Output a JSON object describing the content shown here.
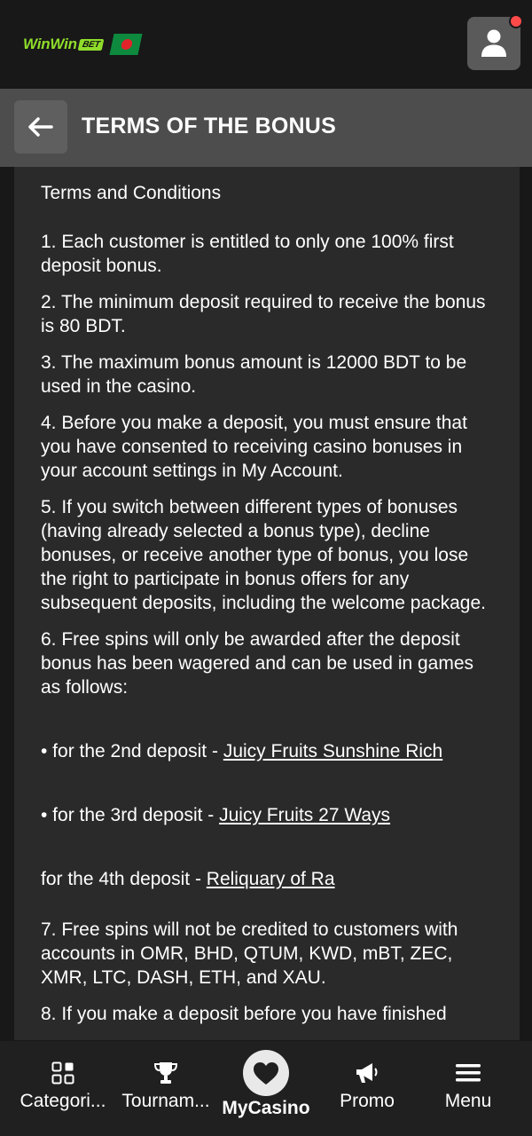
{
  "brand": {
    "logo_text": "WinWin",
    "logo_badge": "BET"
  },
  "header": {
    "title": "TERMS OF THE BONUS"
  },
  "terms": {
    "heading": "Terms and Conditions",
    "items": [
      "1. Each customer is entitled to only one 100% first deposit bonus.",
      "2. The minimum deposit required to receive the bonus is 80 BDT.",
      "3. The maximum bonus amount is 12000 BDT to be used in the casino.",
      "4. Before you make a deposit, you must ensure that you have consented to receiving casino bonuses in your account settings in My Account.",
      "5. If you switch between different types of bonuses (having already selected a bonus type), decline bonuses, or receive another type of bonus, you lose the right to participate in bonus offers for any subsequent deposits, including the welcome package.",
      "6. Free spins will only be awarded after the deposit bonus has been wagered and can be used in games as follows:"
    ],
    "games": [
      {
        "prefix": "• for the 2nd deposit - ",
        "link": "Juicy Fruits Sunshine Rich"
      },
      {
        "prefix": "• for the 3rd deposit - ",
        "link": "Juicy Fruits 27 Ways"
      },
      {
        "prefix": "for the 4th deposit - ",
        "link": "Reliquary of Ra"
      }
    ],
    "item7": "7. Free spins will not be credited to customers with accounts in OMR, BHD, QTUM, KWD, mBT, ZEC, XMR, LTC, DASH, ETH, and XAU.",
    "item8": "8. If you make a deposit before you have finished"
  },
  "nav": {
    "categories": "Categori...",
    "tournaments": "Tournam...",
    "mycasino": "MyCasino",
    "promo": "Promo",
    "menu": "Menu"
  },
  "colors": {
    "brand_green": "#8fdd2b",
    "notification": "#ff4a4a"
  }
}
